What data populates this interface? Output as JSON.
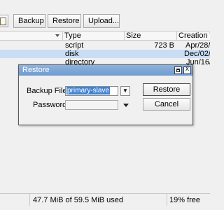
{
  "toolbar": {
    "buttons": [
      "Backup",
      "Restore",
      "Upload..."
    ]
  },
  "table": {
    "columns": [
      "Type",
      "Size",
      "Creation Time"
    ],
    "rows": [
      {
        "type": "script",
        "size": "723 B",
        "created": "Apr/28/..."
      },
      {
        "type": "disk",
        "size": "",
        "created": "Dec/02/..."
      },
      {
        "type": "directory",
        "size": "",
        "created": "Jun/16/..."
      }
    ]
  },
  "dialog": {
    "title": "Restore",
    "backup_file_label": "Backup File:",
    "backup_file_value": "primary-slave",
    "password_label": "Password:",
    "password_value": "",
    "restore_button": "Restore",
    "cancel_button": "Cancel",
    "close_glyph": "x"
  },
  "status": {
    "usage": "47.7 MiB of 59.5 MiB used",
    "free": "19% free"
  },
  "colors": {
    "selected_row": "#c9ddf4",
    "title_bar": "#7ea7d6",
    "selection": "#3f83d4"
  },
  "icons": [
    "new-document-icon",
    "sort-arrow-icon",
    "maximize-icon",
    "close-icon",
    "dropdown-arrow-icon"
  ]
}
